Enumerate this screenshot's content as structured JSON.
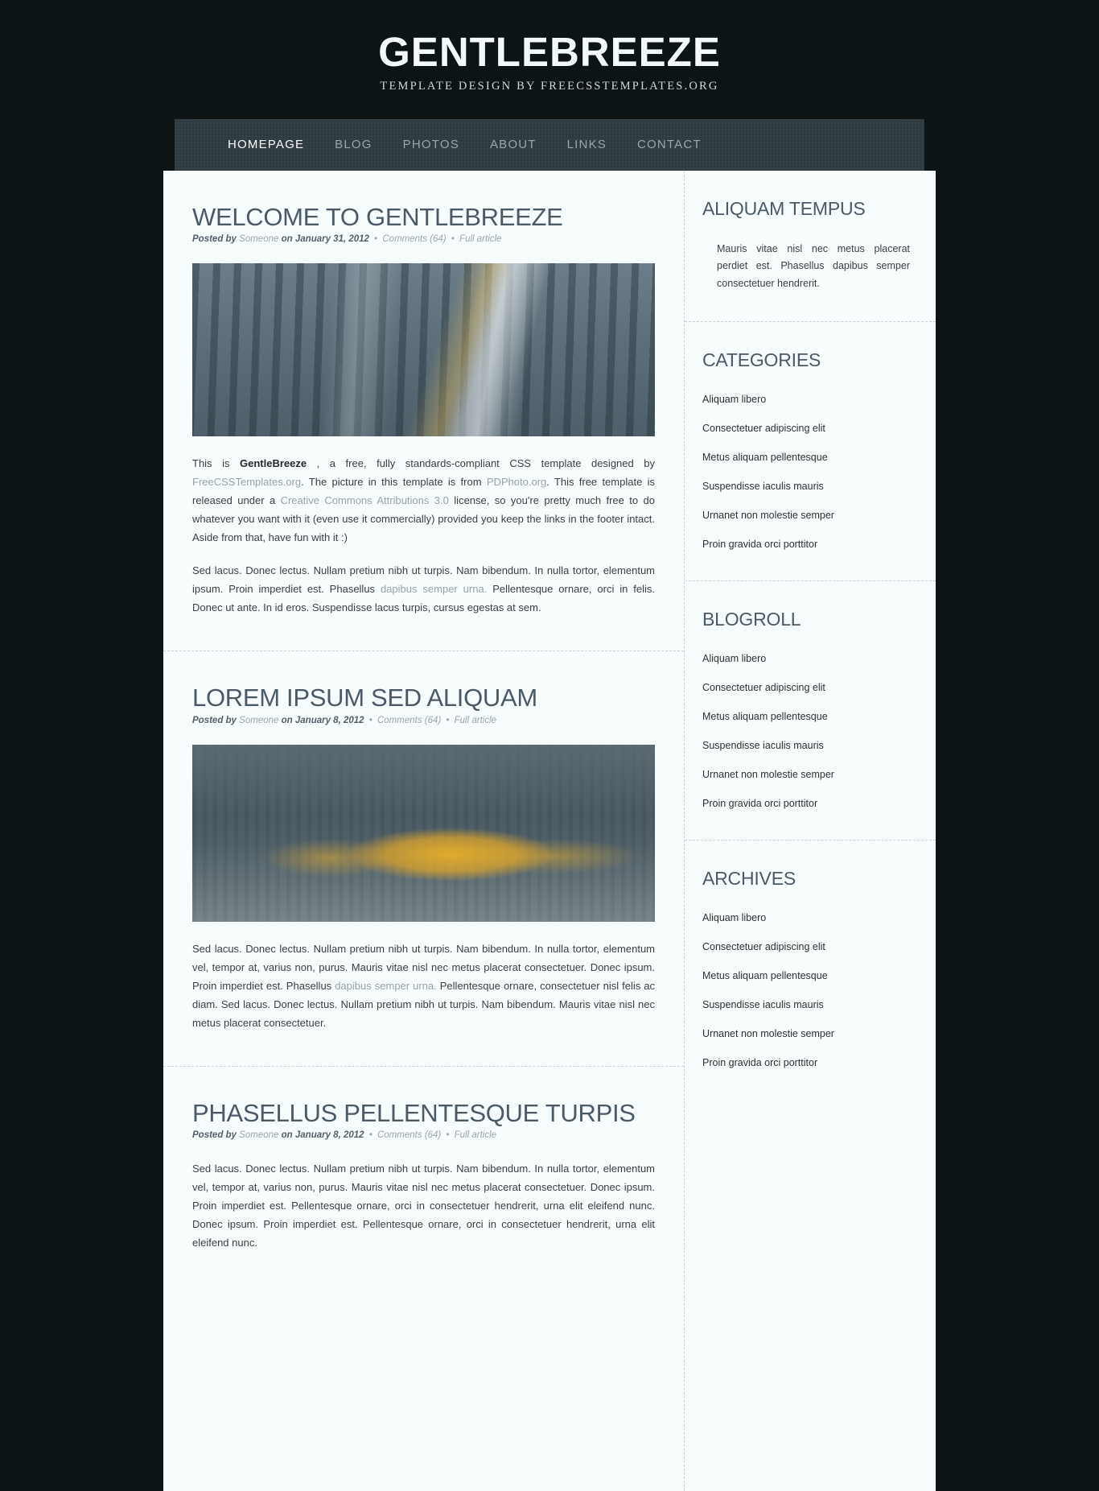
{
  "header": {
    "title": "GENTLEBREEZE",
    "subtitle": "TEMPLATE DESIGN BY FREECSSTEMPLATES.ORG"
  },
  "nav": {
    "items": [
      {
        "label": "HOMEPAGE",
        "current": true
      },
      {
        "label": "BLOG",
        "current": false
      },
      {
        "label": "PHOTOS",
        "current": false
      },
      {
        "label": "ABOUT",
        "current": false
      },
      {
        "label": "LINKS",
        "current": false
      },
      {
        "label": "CONTACT",
        "current": false
      }
    ]
  },
  "posts": [
    {
      "title": "WELCOME TO GENTLEBREEZE",
      "meta": {
        "posted_by_label": "Posted by",
        "author": "Someone",
        "on_label": "on",
        "date": "January 31, 2012",
        "comments": "Comments (64)",
        "full_article": "Full article"
      },
      "has_image": true,
      "paragraphs": [
        "This is GentleBreeze , a free, fully standards-compliant CSS template designed by FreeCSSTemplates.org. The picture in this template is from PDPhoto.org. This free template is released under a Creative Commons Attributions 3.0 license, so you're pretty much free to do whatever you want with it (even use it commercially) provided you keep the links in the footer intact. Aside from that, have fun with it :)",
        "Sed lacus. Donec lectus. Nullam pretium nibh ut turpis. Nam bibendum. In nulla tortor, elementum ipsum. Proin imperdiet est. Phasellus dapibus semper urna. Pellentesque ornare, orci in felis. Donec ut ante. In id eros. Suspendisse lacus turpis, cursus egestas at sem."
      ]
    },
    {
      "title": "LOREM IPSUM SED ALIQUAM",
      "meta": {
        "posted_by_label": "Posted by",
        "author": "Someone",
        "on_label": "on",
        "date": "January 8, 2012",
        "comments": "Comments (64)",
        "full_article": "Full article"
      },
      "has_image": true,
      "paragraphs": [
        "Sed lacus. Donec lectus. Nullam pretium nibh ut turpis. Nam bibendum. In nulla tortor, elementum vel, tempor at, varius non, purus. Mauris vitae nisl nec metus placerat consectetuer. Donec ipsum. Proin imperdiet est. Phasellus dapibus semper urna. Pellentesque ornare, consectetuer nisl felis ac diam. Sed lacus. Donec lectus. Nullam pretium nibh ut turpis. Nam bibendum. Mauris vitae nisl nec metus placerat consectetuer."
      ]
    },
    {
      "title": "PHASELLUS PELLENTESQUE TURPIS",
      "meta": {
        "posted_by_label": "Posted by",
        "author": "Someone",
        "on_label": "on",
        "date": "January 8, 2012",
        "comments": "Comments (64)",
        "full_article": "Full article"
      },
      "has_image": false,
      "paragraphs": [
        "Sed lacus. Donec lectus. Nullam pretium nibh ut turpis. Nam bibendum. In nulla tortor, elementum vel, tempor at, varius non, purus. Mauris vitae nisl nec metus placerat consectetuer. Donec ipsum. Proin imperdiet est. Pellentesque ornare, orci in consectetuer hendrerit, urna elit eleifend nunc. Donec ipsum. Proin imperdiet est. Pellentesque ornare, orci in consectetuer hendrerit, urna elit eleifend nunc."
      ]
    }
  ],
  "sidebar": {
    "boxes": [
      {
        "title": "ALIQUAM TEMPUS",
        "type": "text",
        "text": "Mauris vitae nisl nec metus placerat perdiet est. Phasellus dapibus semper consectetuer hendrerit."
      },
      {
        "title": "CATEGORIES",
        "type": "list",
        "items": [
          "Aliquam libero",
          "Consectetuer adipiscing elit",
          "Metus aliquam pellentesque",
          "Suspendisse iaculis mauris",
          "Urnanet non molestie semper",
          "Proin gravida orci porttitor"
        ]
      },
      {
        "title": "BLOGROLL",
        "type": "list",
        "items": [
          "Aliquam libero",
          "Consectetuer adipiscing elit",
          "Metus aliquam pellentesque",
          "Suspendisse iaculis mauris",
          "Urnanet non molestie semper",
          "Proin gravida orci porttitor"
        ]
      },
      {
        "title": "ARCHIVES",
        "type": "list",
        "items": [
          "Aliquam libero",
          "Consectetuer adipiscing elit",
          "Metus aliquam pellentesque",
          "Suspendisse iaculis mauris",
          "Urnanet non molestie semper",
          "Proin gravida orci porttitor"
        ]
      }
    ]
  },
  "links_in_text": {
    "brand": "GentleBreeze",
    "freecss": "FreeCSSTemplates.org",
    "pdphoto": "PDPhoto.org",
    "cc": "Creative Commons Attributions 3.0",
    "dapibus": "dapibus semper urna."
  },
  "colors": {
    "page_background": "#0d1415",
    "content_background": "#f7fcfc",
    "nav_background": "#2e3b40",
    "heading": "#4a5b67",
    "link": "#98a4ab",
    "active_nav": "#ffffff"
  }
}
